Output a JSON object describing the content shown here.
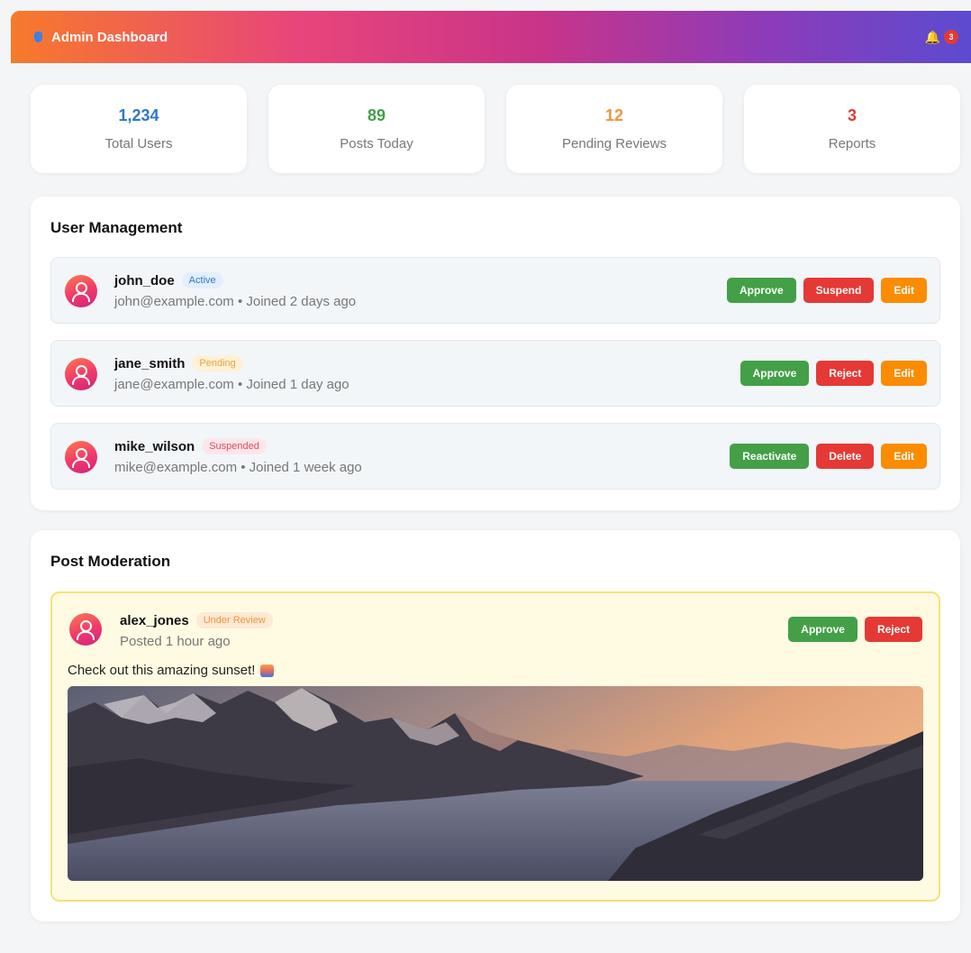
{
  "header": {
    "title": "Admin Dashboard",
    "notification_count": "3",
    "shield_icon": "shield-icon",
    "bell_icon": "bell-icon"
  },
  "stats": [
    {
      "value": "1,234",
      "label": "Total Users",
      "color": "#2f78c8"
    },
    {
      "value": "89",
      "label": "Posts Today",
      "color": "#43a047"
    },
    {
      "value": "12",
      "label": "Pending Reviews",
      "color": "#f0943c"
    },
    {
      "value": "3",
      "label": "Reports",
      "color": "#e53935"
    }
  ],
  "user_management": {
    "title": "User Management",
    "users": [
      {
        "username": "john_doe",
        "status": "Active",
        "meta": "john@example.com • Joined 2 days ago",
        "actions": [
          "Approve",
          "Suspend",
          "Edit"
        ]
      },
      {
        "username": "jane_smith",
        "status": "Pending",
        "meta": "jane@example.com • Joined 1 day ago",
        "actions": [
          "Approve",
          "Reject",
          "Edit"
        ]
      },
      {
        "username": "mike_wilson",
        "status": "Suspended",
        "meta": "mike@example.com • Joined 1 week ago",
        "actions": [
          "Reactivate",
          "Delete",
          "Edit"
        ]
      }
    ]
  },
  "post_moderation": {
    "title": "Post Moderation",
    "post": {
      "username": "alex_jones",
      "status": "Under Review",
      "meta": "Posted 1 hour ago",
      "text": "Check out this amazing sunset!",
      "actions": [
        "Approve",
        "Reject"
      ]
    }
  }
}
